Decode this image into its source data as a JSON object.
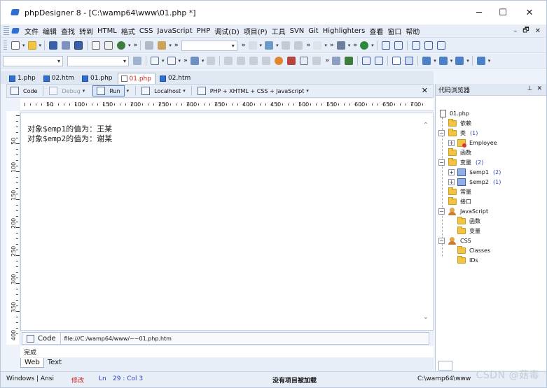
{
  "window": {
    "title": "phpDesigner 8 - [C:\\wamp64\\www\\01.php *]",
    "controls": {
      "minimize": "─",
      "maximize": "☐",
      "close": "✕"
    }
  },
  "menu": {
    "items": [
      "文件",
      "编辑",
      "查找",
      "转到",
      "HTML",
      "格式",
      "CSS",
      "JavaScript",
      "PHP",
      "调试(D)",
      "项目(P)",
      "工具",
      "SVN",
      "Git",
      "Highlighters",
      "查看",
      "窗口",
      "帮助"
    ],
    "mdi_controls": {
      "minimize": "–",
      "restore": "🗗",
      "close": "✕"
    }
  },
  "tabs": [
    {
      "label": "1.php",
      "active": false
    },
    {
      "label": "02.htm",
      "active": false
    },
    {
      "label": "01.php",
      "active": false
    },
    {
      "label": "01.php",
      "active": true
    },
    {
      "label": "02.htm",
      "active": false
    }
  ],
  "editor_toolbar": {
    "code": "Code",
    "debug": "Debug",
    "run": "Run",
    "localhost": "Localhost",
    "mode": "PHP + XHTML + CSS + JavaScript",
    "close": "✕"
  },
  "ruler": {
    "labels": [
      "50",
      "100",
      "150",
      "200",
      "250",
      "300",
      "350",
      "400",
      "450",
      "500",
      "550",
      "600",
      "650",
      "700"
    ]
  },
  "vruler": {
    "labels": [
      "50",
      "100",
      "150",
      "200",
      "250",
      "300",
      "350",
      "400"
    ]
  },
  "editor": {
    "lines": [
      "对象$emp1的值为：王某",
      "对象$emp2的值为：谢某"
    ]
  },
  "urlbar": {
    "code_label": "Code",
    "url": "file:///C:/wamp64/www/~~01.php.htm"
  },
  "browser": {
    "status": "完成",
    "tabs": [
      {
        "label": "Web",
        "active": true
      },
      {
        "label": "Text",
        "active": false
      }
    ]
  },
  "side_panel": {
    "title": "代码浏览器",
    "pin": "⊥",
    "close": "✕",
    "tree": {
      "root": "01.php",
      "dependencies": "依赖",
      "classes": {
        "label": "类",
        "count": "(1)",
        "children": [
          "Employee"
        ]
      },
      "functions": "函数",
      "variables": {
        "label": "变量",
        "count": "(2)",
        "children": [
          {
            "label": "$emp1",
            "count": "(2)"
          },
          {
            "label": "$emp2",
            "count": "(1)"
          }
        ]
      },
      "constants": "常量",
      "interfaces": "接口",
      "javascript": {
        "label": "JavaScript",
        "children": [
          "函数",
          "变量"
        ]
      },
      "css": {
        "label": "CSS",
        "children": [
          "Classes",
          "IDs"
        ]
      }
    }
  },
  "status_bar": {
    "encoding": "Windows | Ansi",
    "modified": "修改",
    "ln_label": "Ln",
    "position": "29 : Col  3",
    "project": "没有项目被加载",
    "path": "C:\\wamp64\\www"
  },
  "watermark": "CSDN @菇毒",
  "colors": {
    "accent": "#2f6fd1",
    "modified": "#cc2222",
    "count": "#2a3fbf"
  }
}
